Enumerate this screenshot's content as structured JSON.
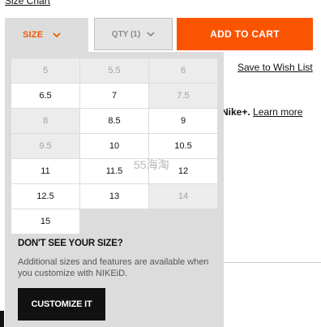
{
  "header": {
    "size_chart_link": "Size Chart"
  },
  "size_selector": {
    "label": "SIZE"
  },
  "qty_selector": {
    "label": "QTY (1)"
  },
  "add_to_cart": {
    "label": "ADD TO CART"
  },
  "wishlist": {
    "label": "Save to Wish List"
  },
  "nikeplus": {
    "prefix": "Nike+.",
    "link": "Learn more"
  },
  "watermark": {
    "text": "55海淘"
  },
  "size_grid": {
    "sizes": [
      {
        "label": "5",
        "available": false
      },
      {
        "label": "5.5",
        "available": false
      },
      {
        "label": "6",
        "available": false
      },
      {
        "label": "6.5",
        "available": true
      },
      {
        "label": "7",
        "available": true
      },
      {
        "label": "7.5",
        "available": false
      },
      {
        "label": "8",
        "available": false
      },
      {
        "label": "8.5",
        "available": true
      },
      {
        "label": "9",
        "available": true
      },
      {
        "label": "9.5",
        "available": false
      },
      {
        "label": "10",
        "available": true
      },
      {
        "label": "10.5",
        "available": true
      },
      {
        "label": "11",
        "available": true
      },
      {
        "label": "11.5",
        "available": true
      },
      {
        "label": "12",
        "available": true
      },
      {
        "label": "12.5",
        "available": true
      },
      {
        "label": "13",
        "available": true
      },
      {
        "label": "14",
        "available": false
      },
      {
        "label": "15",
        "available": true
      }
    ]
  },
  "customize": {
    "title": "DON'T SEE YOUR SIZE?",
    "text": "Additional sizes and features are available when you customize with NIKEiD.",
    "button": "CUSTOMIZE IT"
  },
  "colors": {
    "accent": "#fa5400",
    "size_label": "#f05a00",
    "dark": "#111111"
  }
}
